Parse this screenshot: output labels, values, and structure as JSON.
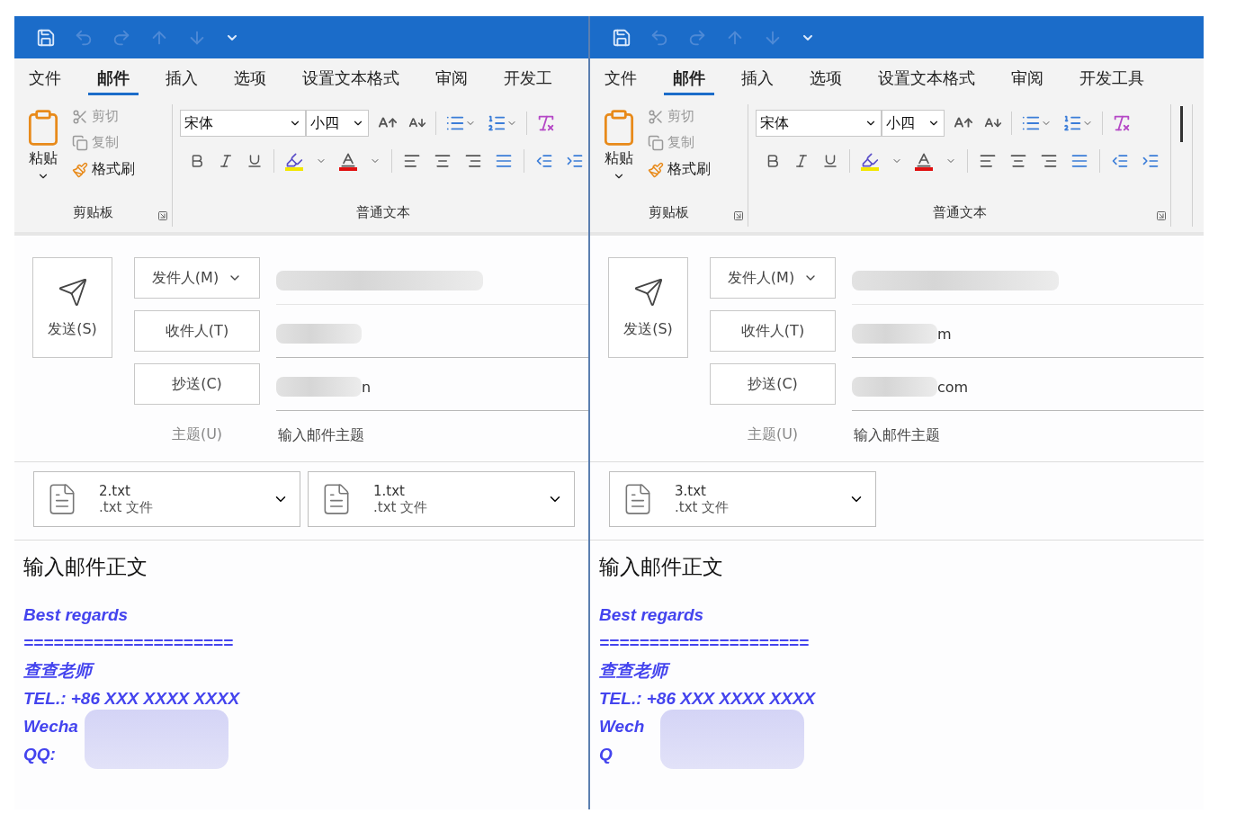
{
  "panes": [
    {
      "tabs": [
        {
          "label": "文件",
          "selected": false
        },
        {
          "label": "邮件",
          "selected": true
        },
        {
          "label": "插入",
          "selected": false
        },
        {
          "label": "选项",
          "selected": false
        },
        {
          "label": "设置文本格式",
          "selected": false
        },
        {
          "label": "审阅",
          "selected": false
        },
        {
          "label": "开发工",
          "selected": false
        }
      ],
      "clipboard": {
        "paste": "粘贴",
        "cut": "剪切",
        "copy": "复制",
        "painter": "格式刷",
        "group": "剪贴板"
      },
      "font": {
        "name": "宋体",
        "size": "小四",
        "group": "普通文本"
      },
      "more_groups": false,
      "send": "发送(S)",
      "fields": [
        {
          "label": "发件人(M)",
          "kind": "dropdown",
          "redacted": true
        },
        {
          "label": "收件人(T)",
          "kind": "button",
          "redacted": true
        },
        {
          "label": "抄送(C)",
          "kind": "button",
          "redacted": true,
          "value": "n"
        }
      ],
      "subject": {
        "label": "主题(U)",
        "placeholder": "输入邮件主题"
      },
      "attachments": [
        {
          "name": "2.txt",
          "type": ".txt 文件"
        },
        {
          "name": "1.txt",
          "type": ".txt 文件"
        }
      ],
      "body": {
        "placeholder": "输入邮件正文",
        "signature": [
          "Best regards",
          "=====================",
          "查查老师",
          "TEL.: +86 XXX XXXX XXXX",
          "Wecha",
          "QQ:"
        ],
        "redacted": true
      }
    },
    {
      "tabs": [
        {
          "label": "文件",
          "selected": false
        },
        {
          "label": "邮件",
          "selected": true
        },
        {
          "label": "插入",
          "selected": false
        },
        {
          "label": "选项",
          "selected": false
        },
        {
          "label": "设置文本格式",
          "selected": false
        },
        {
          "label": "审阅",
          "selected": false
        },
        {
          "label": "开发工具",
          "selected": false
        }
      ],
      "clipboard": {
        "paste": "粘贴",
        "cut": "剪切",
        "copy": "复制",
        "painter": "格式刷",
        "group": "剪贴板"
      },
      "font": {
        "name": "宋体",
        "size": "小四",
        "group": "普通文本"
      },
      "more_groups": true,
      "send": "发送(S)",
      "fields": [
        {
          "label": "发件人(M)",
          "kind": "dropdown",
          "redacted": true
        },
        {
          "label": "收件人(T)",
          "kind": "button",
          "redacted": true,
          "value": "m"
        },
        {
          "label": "抄送(C)",
          "kind": "button",
          "redacted": true,
          "value": "com"
        }
      ],
      "subject": {
        "label": "主题(U)",
        "placeholder": "输入邮件主题"
      },
      "attachments": [
        {
          "name": "3.txt",
          "type": ".txt 文件"
        }
      ],
      "body": {
        "placeholder": "输入邮件正文",
        "signature": [
          "Best regards",
          "=====================",
          "查查老师",
          "TEL.: +86 XXX XXXX XXXX",
          "Wech",
          "Q"
        ],
        "redacted": true
      }
    }
  ]
}
